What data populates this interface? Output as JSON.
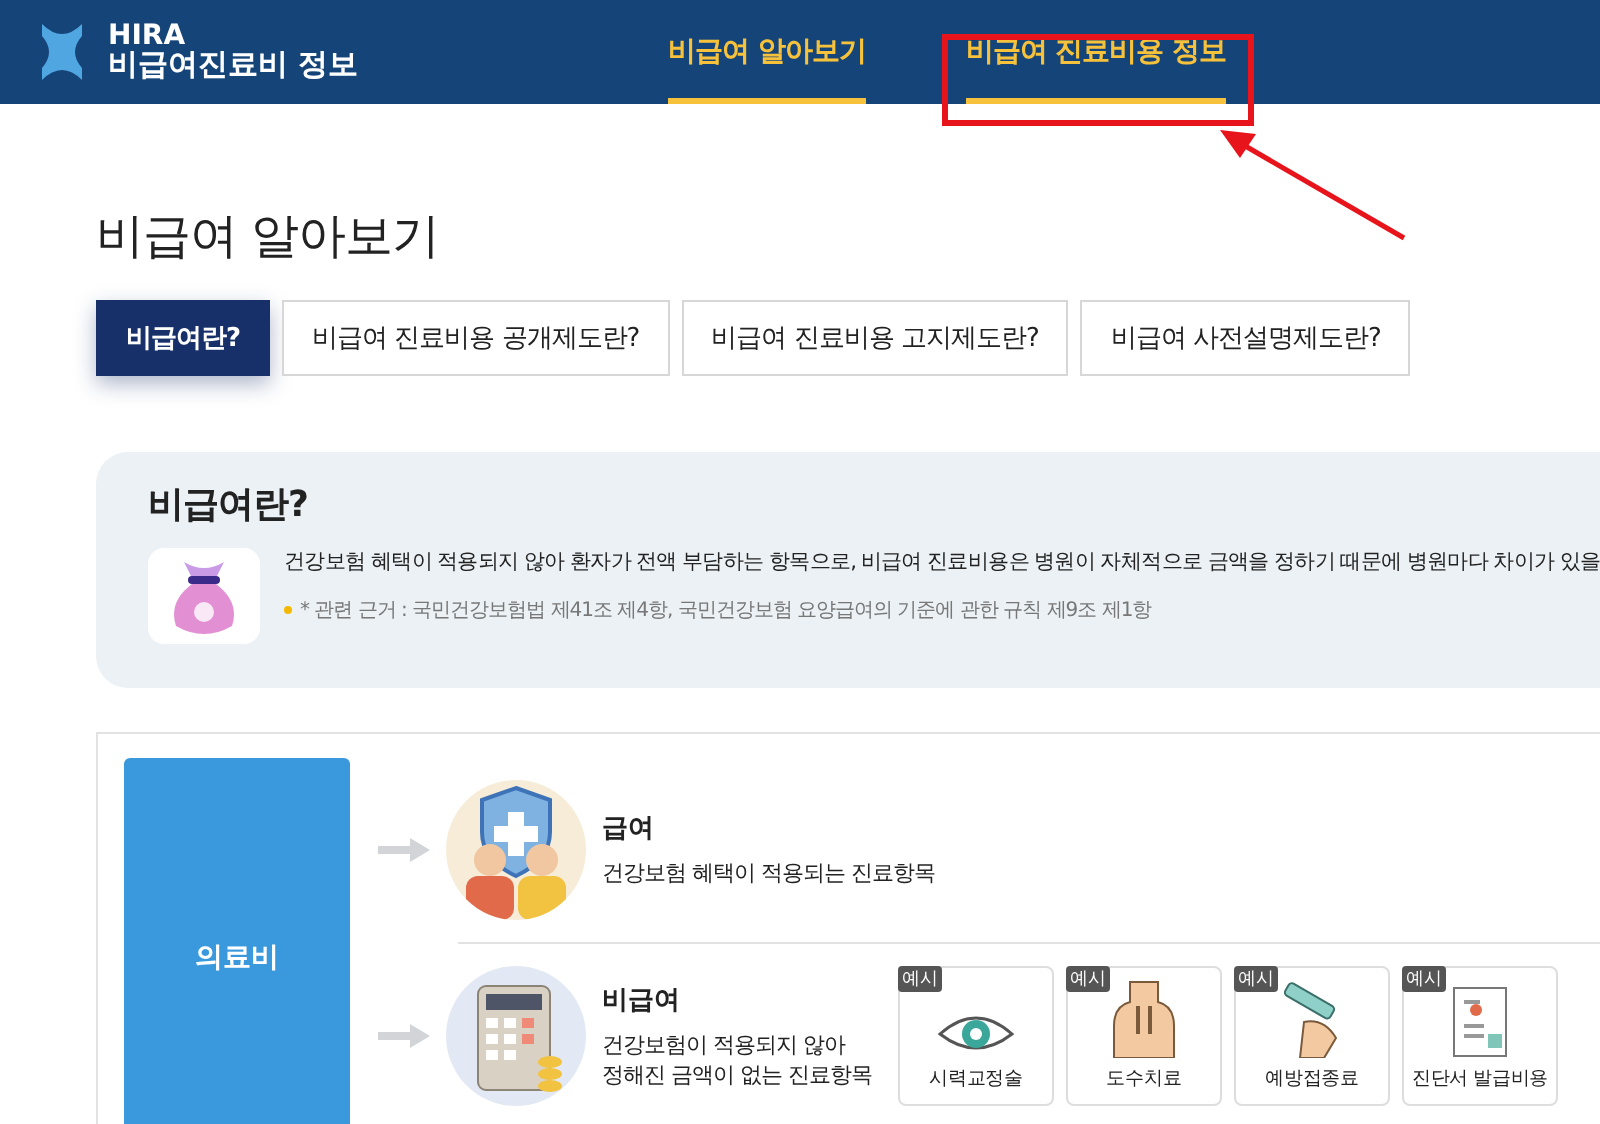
{
  "header": {
    "logo_title": "HIRA",
    "logo_subtitle": "비급여진료비 정보"
  },
  "nav": [
    {
      "label": "비급여 알아보기",
      "highlighted": false
    },
    {
      "label": "비급여 진료비용 정보",
      "highlighted": true
    }
  ],
  "page_title": "비급여 알아보기",
  "tabs": [
    {
      "label": "비급여란?",
      "selected": true
    },
    {
      "label": "비급여 진료비용 공개제도란?",
      "selected": false
    },
    {
      "label": "비급여 진료비용 고지제도란?",
      "selected": false
    },
    {
      "label": "비급여 사전설명제도란?",
      "selected": false
    }
  ],
  "info": {
    "title": "비급여란?",
    "description": "건강보험 혜택이 적용되지 않아 환자가 전액 부담하는 항목으로, 비급여 진료비용은 병원이 자체적으로 금액을 정하기 때문에 병원마다 차이가 있을",
    "note": "* 관련 근거 : 국민건강보험법 제41조 제4항, 국민건강보험 요양급여의 기준에 관한 규칙 제9조 제1항"
  },
  "diagram": {
    "root": "의료비",
    "branches": [
      {
        "kind": "covered",
        "title": "급여",
        "description": "건강보험 혜택이 적용되는 진료항목"
      },
      {
        "kind": "uncovered",
        "title": "비급여",
        "description": "건강보험이 적용되지 않아\n정해진 금액이 없는 진료항목",
        "examples": [
          {
            "badge": "예시",
            "label": "시력교정술"
          },
          {
            "badge": "예시",
            "label": "도수치료"
          },
          {
            "badge": "예시",
            "label": "예방접종료"
          },
          {
            "badge": "예시",
            "label": "진단서 발급비용"
          }
        ]
      }
    ]
  }
}
